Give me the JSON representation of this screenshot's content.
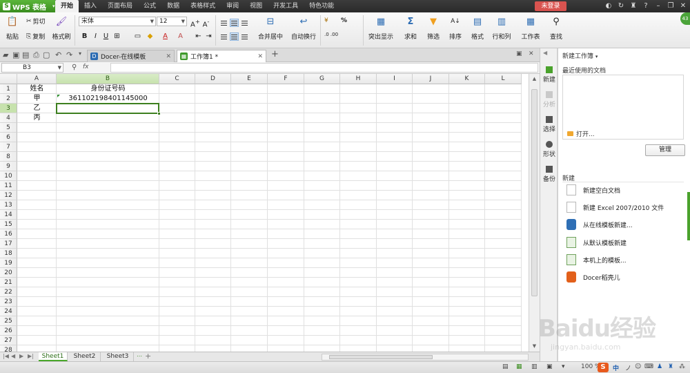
{
  "app": {
    "name": "WPS 表格",
    "logo_letter": "S"
  },
  "menu": {
    "tabs": [
      "开始",
      "插入",
      "页面布局",
      "公式",
      "数据",
      "表格样式",
      "审阅",
      "视图",
      "开发工具",
      "特色功能"
    ],
    "active": "开始",
    "login_label": "未登录"
  },
  "ribbon": {
    "paste": "粘贴",
    "cut": "剪切",
    "copy": "复制",
    "format_painter": "格式刷",
    "font_name": "宋体",
    "font_size": "12",
    "merge_center": "合并居中",
    "auto_wrap": "自动换行",
    "highlight": "突出显示",
    "sum": "求和",
    "filter": "筛选",
    "sort": "排序",
    "format": "格式",
    "row_col": "行和列",
    "worksheet": "工作表",
    "find": "查找"
  },
  "tabs": [
    {
      "label": "Docer-在线模板",
      "active": false
    },
    {
      "label": "工作簿1 *",
      "active": true
    }
  ],
  "formula_bar": {
    "name_box": "B3",
    "fx_label": "fx",
    "formula": ""
  },
  "grid": {
    "columns": [
      "A",
      "B",
      "C",
      "D",
      "E",
      "F",
      "G",
      "H",
      "I",
      "J",
      "K",
      "L"
    ],
    "rows": [
      "1",
      "2",
      "3",
      "4",
      "5",
      "6",
      "7",
      "8",
      "9",
      "10",
      "11",
      "12",
      "13",
      "14",
      "15",
      "16",
      "17",
      "18",
      "19",
      "20",
      "21",
      "22",
      "23",
      "24",
      "25",
      "26",
      "27",
      "28"
    ],
    "selected_cell": "B3",
    "cells": {
      "A1": "姓名",
      "B1": "身份证号码",
      "A2": "甲",
      "B2": "361102198401145000",
      "A3": "乙",
      "A4": "丙"
    }
  },
  "sheets": {
    "tabs": [
      "Sheet1",
      "Sheet2",
      "Sheet3"
    ],
    "active": "Sheet1"
  },
  "status": {
    "zoom": "100 %",
    "ime": "中"
  },
  "side_strip": [
    "新建",
    "分析",
    "选择",
    "形状",
    "备份"
  ],
  "task_pane": {
    "title": "新建工作簿",
    "recent_label": "最近使用的文档",
    "open_label": "打开...",
    "manage_label": "管理",
    "new_label": "新建",
    "new_items": [
      "新建空白文档",
      "新建 Excel 2007/2010 文件",
      "从在线模板新建...",
      "从默认模板新建",
      "本机上的模板...",
      "Docer稻壳儿"
    ]
  },
  "badge": "43",
  "watermark": {
    "text": "Baidu经验",
    "url": "jingyan.baidu.com"
  },
  "colors": {
    "accent": "#3a8d1f",
    "selection": "#3d7f1f",
    "menubar": "#2f2f2f",
    "login": "#d9534f"
  },
  "icons": {
    "paste": "clipboard-icon",
    "cut": "scissors-icon",
    "copy": "copy-icon",
    "format_painter": "brush-icon",
    "sum": "sigma-icon",
    "filter": "funnel-icon"
  }
}
